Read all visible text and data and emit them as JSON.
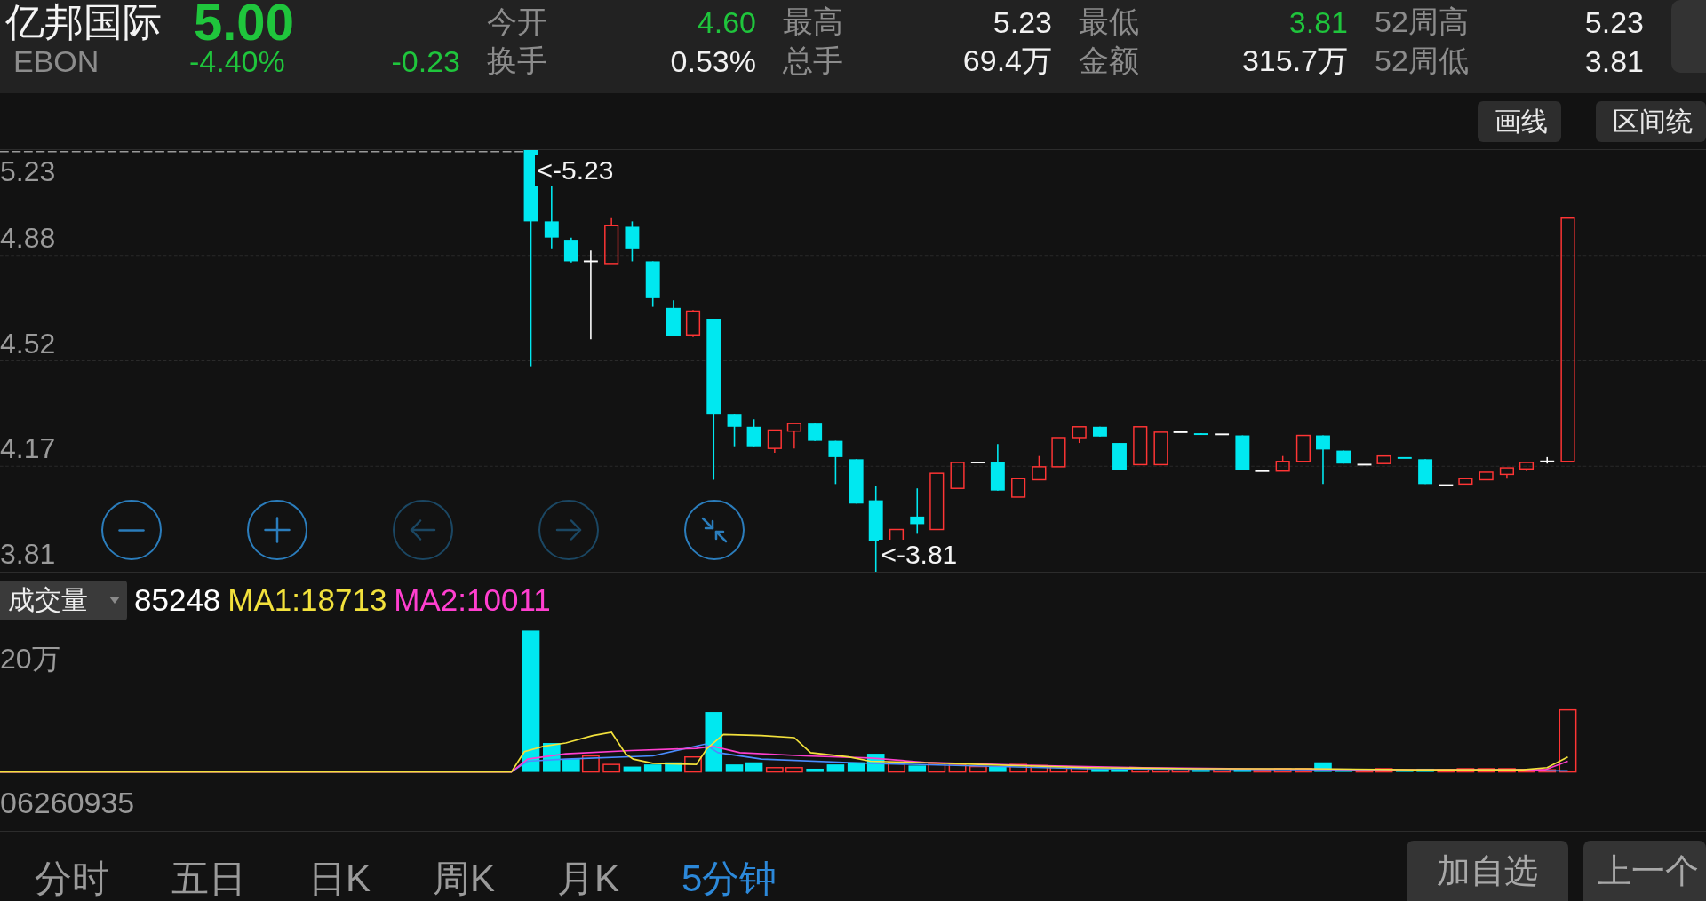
{
  "stock": {
    "name": "亿邦国际",
    "code": "EBON",
    "price": "5.00",
    "change_percent": "-4.40%",
    "change": "-0.23",
    "color": "#1fc53c"
  },
  "quote_stats": [
    {
      "label": "今开",
      "value": "4.60",
      "color": "#1fc53c"
    },
    {
      "label": "最高",
      "value": "5.23",
      "color": "#f2f2f2"
    },
    {
      "label": "最低",
      "value": "3.81",
      "color": "#1fc53c"
    },
    {
      "label": "52周高",
      "value": "5.23",
      "color": "#f2f2f2"
    },
    {
      "label": "换手",
      "value": "0.53%",
      "color": "#f2f2f2"
    },
    {
      "label": "总手",
      "value": "69.4万",
      "color": "#f2f2f2"
    },
    {
      "label": "金额",
      "value": "315.7万",
      "color": "#f2f2f2"
    },
    {
      "label": "52周低",
      "value": "3.81",
      "color": "#f2f2f2"
    }
  ],
  "chart_toolbar": {
    "buttons": [
      "画线",
      "区间统"
    ]
  },
  "price_chart": {
    "axis_labels": [
      "5.23",
      "4.88",
      "4.52",
      "4.17",
      "3.81"
    ],
    "high_marker": "<-5.23",
    "low_marker": "<-3.81",
    "controls": [
      {
        "kind": "zoom_out",
        "disabled": false
      },
      {
        "kind": "zoom_in",
        "disabled": false
      },
      {
        "kind": "pan_left",
        "disabled": true
      },
      {
        "kind": "pan_right",
        "disabled": true
      },
      {
        "kind": "reset",
        "disabled": false
      }
    ]
  },
  "volume_panel": {
    "indicator": "成交量",
    "legend": [
      {
        "text": "85248",
        "color": "#ffffff"
      },
      {
        "text": "MA1:18713",
        "color": "#f2e13c"
      },
      {
        "text": "MA2:10011",
        "color": "#ff3fcf"
      }
    ],
    "axis_label": "20万",
    "time_label": "06260935"
  },
  "period_tabs": [
    {
      "label": "分时",
      "selected": false
    },
    {
      "label": "五日",
      "selected": false
    },
    {
      "label": "日K",
      "selected": false
    },
    {
      "label": "周K",
      "selected": false
    },
    {
      "label": "月K",
      "selected": false
    },
    {
      "label": "5分钟",
      "selected": true
    }
  ],
  "action_buttons": [
    "加自选",
    "上一个"
  ]
}
